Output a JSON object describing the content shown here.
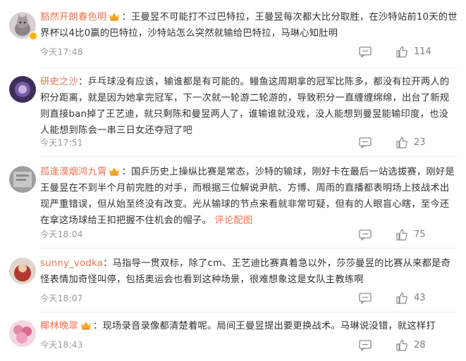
{
  "comments": [
    {
      "username": "豁然开朗春色明",
      "text": "王曼昱不可能打不过巴特拉，王曼昱每次都大比分取胜，在沙特站前10天的世界杯以4比0赢的巴特拉，沙特站怎么突然就输给巴特拉，马琳心知肚明",
      "link": "",
      "time": "今天17:48",
      "likes": "114",
      "avatar_color": "#c9c2c6"
    },
    {
      "username": "研史之沙",
      "text": "乒乓球没有应该，输谁都是有可能的。鳗鱼这周期拿的冠军比陈多，都没有拉开两人的积分距离，就是因为她拿完冠军，下一次就一轮游二轮游的，导致积分一直缠缠绵绵，出台了新规则直接ban掉了王艺迪，就只剩陈和曼昱两人了，谁输谁就没戏，没人能想到曼昱能输印度，也没人能想到陈会一串三日女还夺冠了吧",
      "link": "",
      "time": "今天17:51",
      "likes": "23",
      "avatar_color": "#6b4f8a"
    },
    {
      "username": "孤逢漠烟鸿九霄",
      "text": "国乒历史上操纵比赛是常态，沙特的输球，刚好卡在最后一站选拔赛，刚好是王曼昱在不到半个月前完胜的对手，而根据三位解说尹航、方博、周雨的直播都表明场上技战术出现严重错误，但从始至终没有改变。光从输球的节点来看就非常可疑，但有的人眼盲心瞎，至今还在拿这场球给王扣把握不住机会的帽子。",
      "link": "评论配图",
      "time": "今天18:04",
      "likes": "75",
      "avatar_color": "#bdbdbd"
    },
    {
      "username": "sunny_vodka",
      "text": "马指导一贯双标，除了cm、王艺迪比赛真着急以外，莎莎曼昱的比赛从来都是奇怪表情加奇怪叫停，包括奥运会也看到这种场景，很难想象这是女队主教练啊",
      "link": "",
      "time": "今天18:07",
      "likes": "43",
      "avatar_color": "#c0392b"
    },
    {
      "username": "椰林晚翠",
      "text": "现场录音录像都清楚着呢。局间王曼昱提出要更换战术。马琳说没错，就这样打",
      "link": "",
      "time": "今天18:43",
      "likes": "28",
      "avatar_color": "#e8a0b8"
    }
  ],
  "colors": {
    "username": "#eb7350",
    "text": "#333333",
    "meta": "#999999",
    "crown": "#f5a623"
  },
  "icons": {
    "badge": "crown-icon",
    "reply": "reply-icon",
    "like": "thumb-up-icon"
  }
}
